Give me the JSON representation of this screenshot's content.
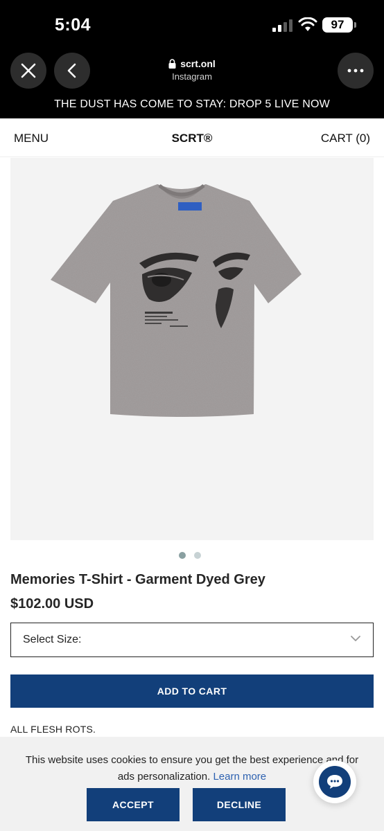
{
  "status_bar": {
    "time": "5:04",
    "battery": "97"
  },
  "browser": {
    "url": "scrt.onl",
    "source": "Instagram",
    "icons": [
      "close-icon",
      "back-chevron-icon",
      "lock-icon",
      "more-dots-icon"
    ]
  },
  "announcement": "THE DUST HAS COME TO STAY: DROP 5 LIVE NOW",
  "header": {
    "menu_label": "MENU",
    "logo": "SCRT®",
    "cart_label": "CART (0)"
  },
  "product": {
    "title": "Memories T-Shirt - Garment Dyed Grey",
    "price": "$102.00 USD",
    "image_count": 2,
    "active_image": 1,
    "size_select_label": "Select Size:",
    "add_to_cart_label": "ADD TO CART",
    "description": "ALL FLESH ROTS."
  },
  "cookie_banner": {
    "text": "This website uses cookies to ensure you get the best experience and for ads personalization.",
    "learn_more": "Learn more",
    "accept_label": "ACCEPT",
    "decline_label": "DECLINE"
  },
  "colors": {
    "brand_blue": "#123f7a",
    "link_blue": "#2d61b0",
    "shirt_grey": "#9a9595"
  }
}
